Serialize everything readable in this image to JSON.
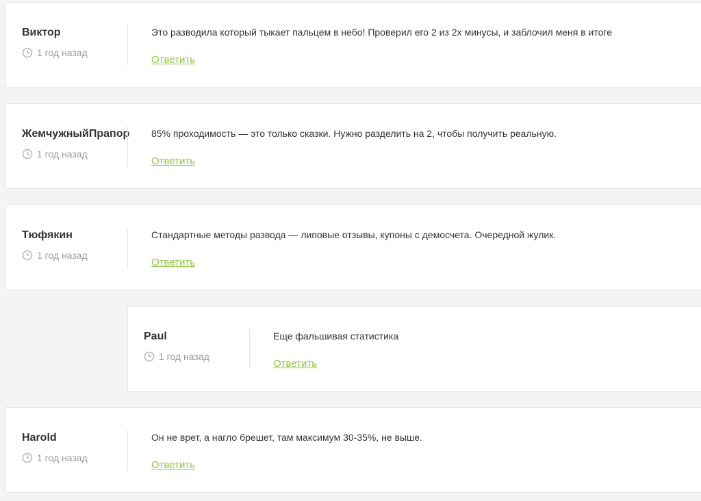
{
  "colors": {
    "accent": "#8cc63f",
    "background": "#f4f4f4",
    "card": "#ffffff",
    "muted": "#9a9a9a",
    "text": "#333333"
  },
  "comments": [
    {
      "author": "Виктор",
      "time": "1 год назад",
      "text": "Это разводила который тыкает пальцем в небо! Проверил его 2 из 2х минусы, и заблочил меня в итоге",
      "reply_label": "Ответить",
      "time_icon": "clock-icon"
    },
    {
      "author": "ЖемчужныйПрапор",
      "time": "1 год назад",
      "text": "85% проходимость — это только сказки. Нужно разделить на 2, чтобы получить реальную.",
      "reply_label": "Ответить",
      "time_icon": "clock-icon"
    },
    {
      "author": "Тюфякин",
      "time": "1 год назад",
      "text": "Стандартные методы развода — липовые отзывы, купоны с демосчета. Очередной жулик.",
      "reply_label": "Ответить",
      "time_icon": "clock-icon"
    },
    {
      "author": "Paul",
      "time": "1 год назад",
      "text": "Еще фальшивая статистика",
      "reply_label": "Ответить",
      "time_icon": "clock-icon",
      "is_reply": true
    },
    {
      "author": "Harold",
      "time": "1 год назад",
      "text": "Он не врет, а нагло брешет, там максимум 30-35%, не выше.",
      "reply_label": "Ответить",
      "time_icon": "clock-icon"
    }
  ]
}
